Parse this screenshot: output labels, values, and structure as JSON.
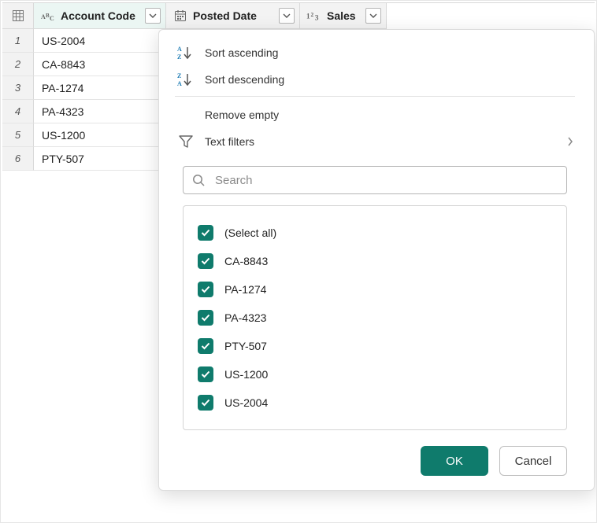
{
  "columns": {
    "account": {
      "label": "Account Code"
    },
    "date": {
      "label": "Posted Date"
    },
    "sales": {
      "label": "Sales"
    }
  },
  "rows": [
    {
      "num": "1",
      "account": "US-2004"
    },
    {
      "num": "2",
      "account": "CA-8843"
    },
    {
      "num": "3",
      "account": "PA-1274"
    },
    {
      "num": "4",
      "account": "PA-4323"
    },
    {
      "num": "5",
      "account": "US-1200"
    },
    {
      "num": "6",
      "account": "PTY-507"
    }
  ],
  "menu": {
    "sort_asc": "Sort ascending",
    "sort_desc": "Sort descending",
    "remove_empty": "Remove empty",
    "text_filters": "Text filters"
  },
  "search": {
    "placeholder": "Search"
  },
  "filter_values": [
    {
      "label": "(Select all)"
    },
    {
      "label": "CA-8843"
    },
    {
      "label": "PA-1274"
    },
    {
      "label": "PA-4323"
    },
    {
      "label": "PTY-507"
    },
    {
      "label": "US-1200"
    },
    {
      "label": "US-2004"
    }
  ],
  "buttons": {
    "ok": "OK",
    "cancel": "Cancel"
  },
  "colors": {
    "accent": "#0f7b6c"
  }
}
